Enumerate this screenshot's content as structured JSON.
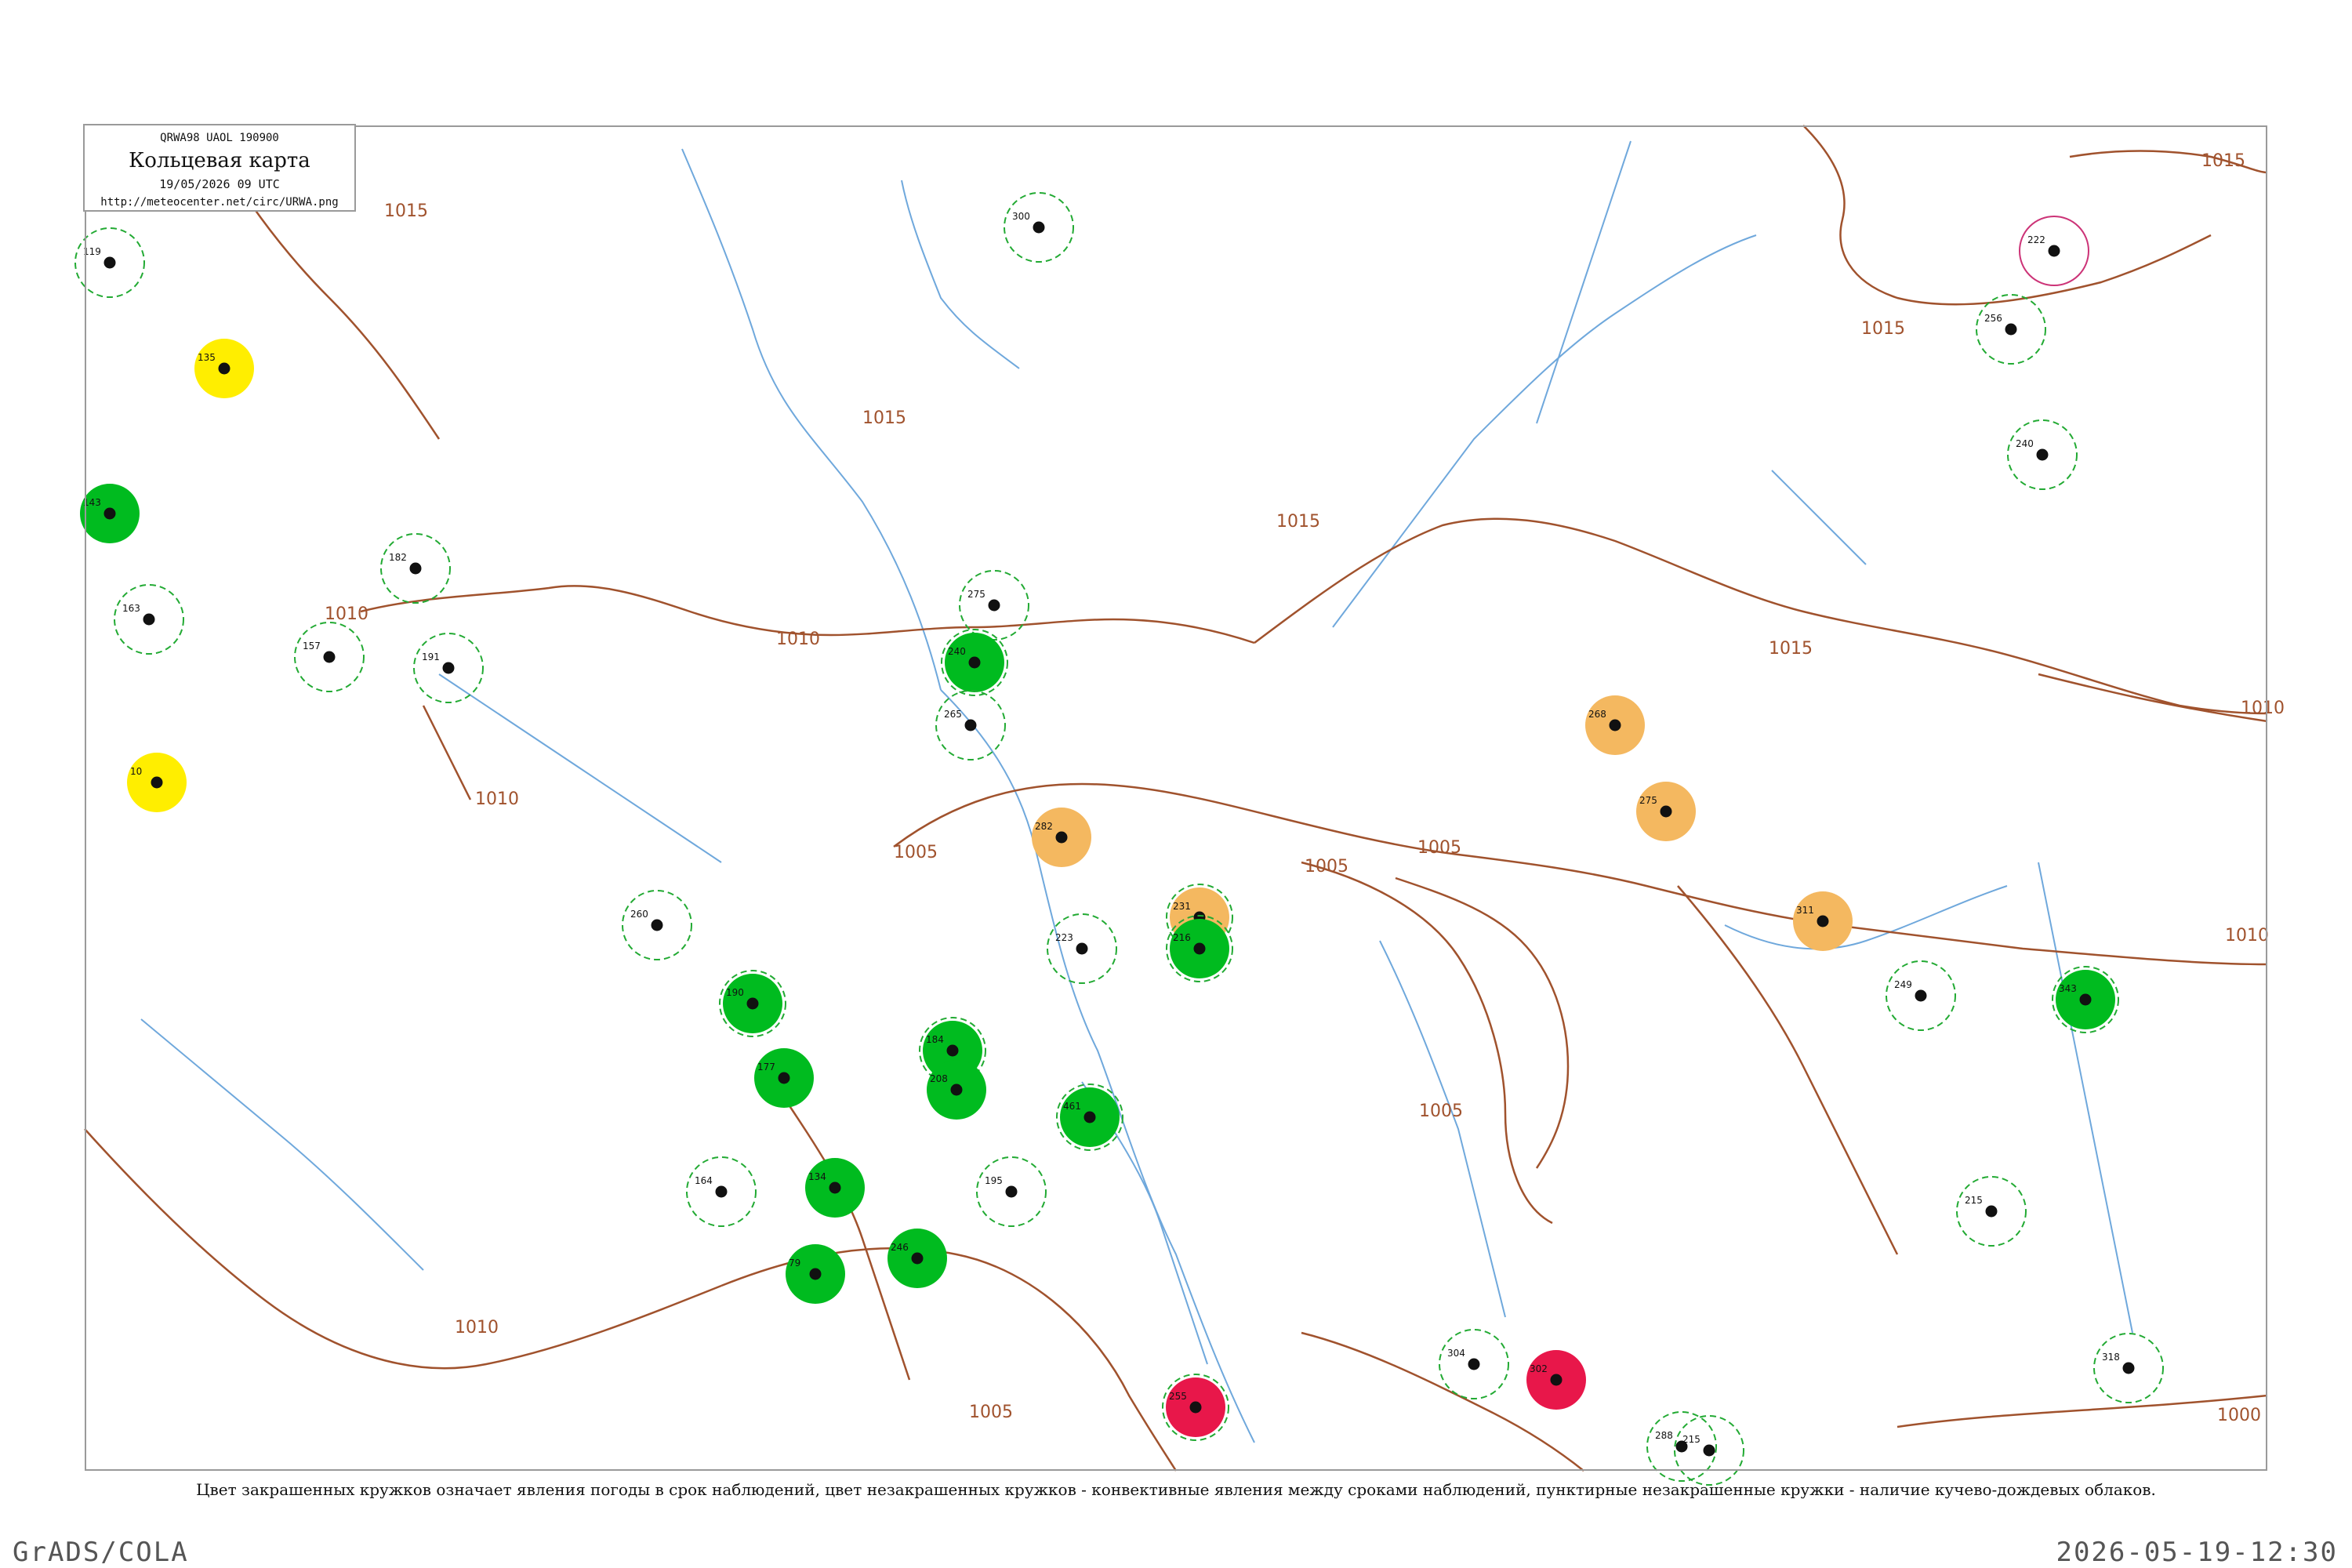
{
  "header": {
    "code": "QRWA98  UAOL  190900",
    "title": "Кольцевая карта",
    "date": "19/05/2026 09 UTC",
    "url": "http://meteocenter.net/circ/URWA.png"
  },
  "footer": {
    "note": "Цвет закрашенных кружков означает явления погоды в срок наблюдений, цвет незакрашенных кружков - конвективные явления между сроками наблюдений, пунктирные незакрашенные кружки - наличие кучево-дождевых облаков.",
    "brand": "GrADS/COLA",
    "timestamp": "2026-05-19-12:30"
  },
  "colors": {
    "isobar": "#a0522d",
    "river": "#6fa8dc",
    "green_fill": "#00bb1f",
    "yellow_fill": "#ffee00",
    "orange_fill": "#f4b860",
    "red_fill": "#e8174a",
    "dashed_ring": "#22aa33",
    "magenta_ring": "#cc3377",
    "frame": "#9a9a9a"
  },
  "isobar_labels": [
    "1015",
    "1015",
    "1015",
    "1010",
    "1010",
    "1015",
    "1010",
    "1005",
    "1005",
    "1005",
    "1010",
    "1005",
    "1005",
    "1010",
    "1000",
    "1015",
    "1015",
    "1010"
  ],
  "stations": [
    {
      "label": "119",
      "fill": "none",
      "ring": "dashed"
    },
    {
      "label": "135",
      "fill": "yellow",
      "ring": "none"
    },
    {
      "label": "163",
      "fill": "none",
      "ring": "dashed"
    },
    {
      "label": "143",
      "fill": "green",
      "ring": "none"
    },
    {
      "label": "10",
      "fill": "yellow",
      "ring": "none"
    },
    {
      "label": "182",
      "fill": "none",
      "ring": "dashed"
    },
    {
      "label": "191",
      "fill": "none",
      "ring": "dashed"
    },
    {
      "label": "157",
      "fill": "none",
      "ring": "dashed"
    },
    {
      "label": "275",
      "fill": "none",
      "ring": "dashed"
    },
    {
      "label": "300",
      "fill": "none",
      "ring": "dashed"
    },
    {
      "label": "240",
      "fill": "green",
      "ring": "dashed"
    },
    {
      "label": "265",
      "fill": "none",
      "ring": "dashed"
    },
    {
      "label": "282",
      "fill": "orange",
      "ring": "none"
    },
    {
      "label": "231",
      "fill": "orange",
      "ring": "dashed"
    },
    {
      "label": "216",
      "fill": "green",
      "ring": "dashed"
    },
    {
      "label": "223",
      "fill": "none",
      "ring": "dashed"
    },
    {
      "label": "190",
      "fill": "green",
      "ring": "dashed"
    },
    {
      "label": "177",
      "fill": "green",
      "ring": "none"
    },
    {
      "label": "184",
      "fill": "green",
      "ring": "dashed"
    },
    {
      "label": "208",
      "fill": "green",
      "ring": "none"
    },
    {
      "label": "461",
      "fill": "green",
      "ring": "dashed"
    },
    {
      "label": "195",
      "fill": "none",
      "ring": "dashed"
    },
    {
      "label": "134",
      "fill": "green",
      "ring": "none"
    },
    {
      "label": "164",
      "fill": "none",
      "ring": "dashed"
    },
    {
      "label": "79",
      "fill": "green",
      "ring": "none"
    },
    {
      "label": "246",
      "fill": "green",
      "ring": "none"
    },
    {
      "label": "255",
      "fill": "red",
      "ring": "dashed"
    },
    {
      "label": "302",
      "fill": "red",
      "ring": "none"
    },
    {
      "label": "268",
      "fill": "orange",
      "ring": "none"
    },
    {
      "label": "275",
      "fill": "orange",
      "ring": "none"
    },
    {
      "label": "311",
      "fill": "orange",
      "ring": "none"
    },
    {
      "label": "249",
      "fill": "none",
      "ring": "dashed"
    },
    {
      "label": "343",
      "fill": "green",
      "ring": "dashed"
    },
    {
      "label": "222",
      "fill": "none",
      "ring": "magenta"
    },
    {
      "label": "256",
      "fill": "none",
      "ring": "dashed"
    },
    {
      "label": "240",
      "fill": "none",
      "ring": "dashed"
    },
    {
      "label": "318",
      "fill": "none",
      "ring": "dashed"
    },
    {
      "label": "215",
      "fill": "none",
      "ring": "dashed"
    },
    {
      "label": "304",
      "fill": "none",
      "ring": "dashed"
    },
    {
      "label": "288",
      "fill": "none",
      "ring": "dashed"
    },
    {
      "label": "260",
      "fill": "none",
      "ring": "dashed"
    },
    {
      "label": "215",
      "fill": "none",
      "ring": "dashed"
    }
  ]
}
